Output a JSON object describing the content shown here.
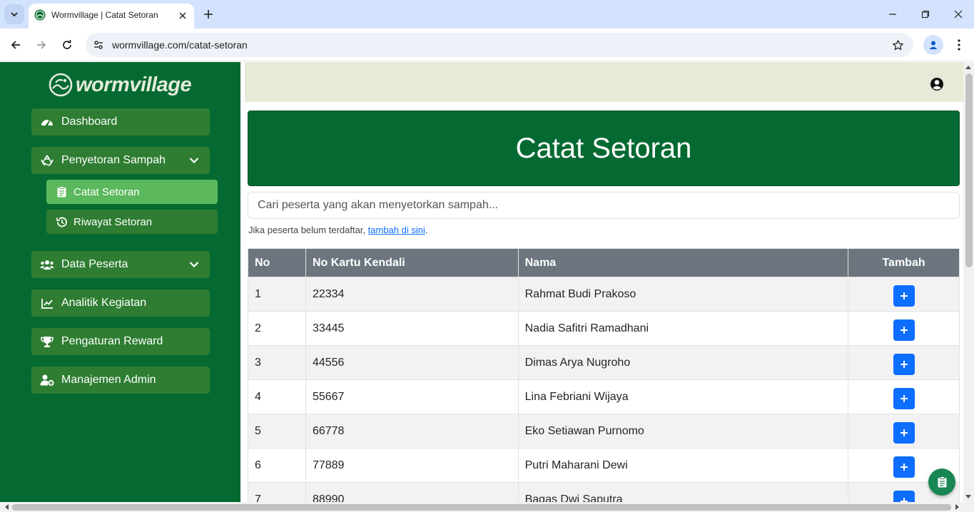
{
  "browser": {
    "tab_title": "Wormvillage | Catat Setoran",
    "url": "wormvillage.com/catat-setoran"
  },
  "sidebar": {
    "brand": "wormvillage",
    "items": [
      {
        "label": "Dashboard",
        "icon": "gauge-icon"
      },
      {
        "label": "Penyetoran Sampah",
        "icon": "recycle-icon",
        "expanded": true
      },
      {
        "label": "Data Peserta",
        "icon": "users-icon",
        "expanded": false
      },
      {
        "label": "Analitik Kegiatan",
        "icon": "chart-line-icon"
      },
      {
        "label": "Pengaturan Reward",
        "icon": "trophy-icon"
      },
      {
        "label": "Manajemen Admin",
        "icon": "user-gear-icon"
      }
    ],
    "subitems": [
      {
        "label": "Catat Setoran",
        "icon": "clipboard-icon",
        "active": true
      },
      {
        "label": "Riwayat Setoran",
        "icon": "history-icon",
        "active": false
      }
    ]
  },
  "main": {
    "title": "Catat Setoran",
    "search_placeholder": "Cari peserta yang akan menyetorkan sampah...",
    "hint_text": "Jika peserta belum terdaftar, ",
    "hint_link": "tambah di sini",
    "hint_end": ".",
    "table": {
      "headers": [
        "No",
        "No Kartu Kendali",
        "Nama",
        "Tambah"
      ],
      "rows": [
        {
          "no": "1",
          "kartu": "22334",
          "nama": "Rahmat Budi Prakoso"
        },
        {
          "no": "2",
          "kartu": "33445",
          "nama": "Nadia Safitri Ramadhani"
        },
        {
          "no": "3",
          "kartu": "44556",
          "nama": "Dimas Arya Nugroho"
        },
        {
          "no": "4",
          "kartu": "55667",
          "nama": "Lina Febriani Wijaya"
        },
        {
          "no": "5",
          "kartu": "66778",
          "nama": "Eko Setiawan Purnomo"
        },
        {
          "no": "6",
          "kartu": "77889",
          "nama": "Putri Maharani Dewi"
        },
        {
          "no": "7",
          "kartu": "88990",
          "nama": "Bagas Dwi Saputra"
        }
      ]
    }
  },
  "colors": {
    "sidebar_bg": "#046a32",
    "nav_item_bg": "#2e7d32",
    "active_item_bg": "#5cb85c",
    "topbar_bg": "#e6ead6",
    "table_header_bg": "#6c757d",
    "add_button_bg": "#0d6efd"
  }
}
